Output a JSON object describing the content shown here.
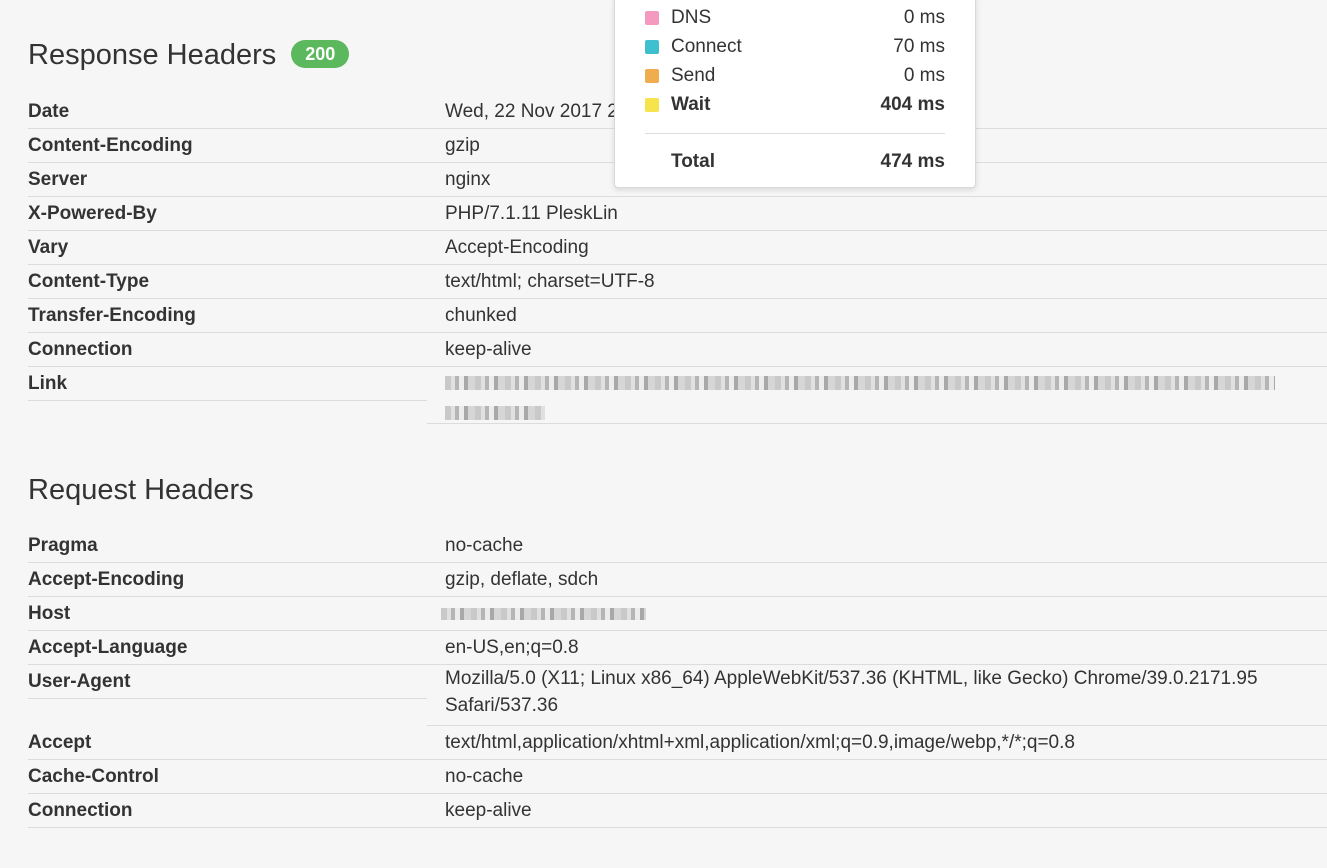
{
  "response": {
    "title": "Response Headers",
    "status": "200",
    "rows": [
      {
        "name": "Date",
        "value": "Wed, 22 Nov 2017 2"
      },
      {
        "name": "Content-Encoding",
        "value": "gzip"
      },
      {
        "name": "Server",
        "value": "nginx"
      },
      {
        "name": "X-Powered-By",
        "value": "PHP/7.1.11 PleskLin"
      },
      {
        "name": "Vary",
        "value": "Accept-Encoding"
      },
      {
        "name": "Content-Type",
        "value": "text/html; charset=UTF-8"
      },
      {
        "name": "Transfer-Encoding",
        "value": "chunked"
      },
      {
        "name": "Connection",
        "value": "keep-alive"
      },
      {
        "name": "Link",
        "value": ""
      }
    ]
  },
  "request": {
    "title": "Request Headers",
    "rows": [
      {
        "name": "Pragma",
        "value": "no-cache"
      },
      {
        "name": "Accept-Encoding",
        "value": "gzip, deflate, sdch"
      },
      {
        "name": "Host",
        "value": ""
      },
      {
        "name": "Accept-Language",
        "value": "en-US,en;q=0.8"
      },
      {
        "name": "User-Agent",
        "value": "Mozilla/5.0 (X11; Linux x86_64) AppleWebKit/537.36 (KHTML, like Gecko) Chrome/39.0.2171.95 Safari/537.36"
      },
      {
        "name": "Accept",
        "value": "text/html,application/xhtml+xml,application/xml;q=0.9,image/webp,*/*;q=0.8"
      },
      {
        "name": "Cache-Control",
        "value": "no-cache"
      },
      {
        "name": "Connection",
        "value": "keep-alive"
      }
    ]
  },
  "timing": {
    "rows": [
      {
        "label": "DNS",
        "value": "0 ms",
        "color": "#f49ac1"
      },
      {
        "label": "Connect",
        "value": "70 ms",
        "color": "#3ec0d0"
      },
      {
        "label": "Send",
        "value": "0 ms",
        "color": "#f0ad4e"
      },
      {
        "label": "Wait",
        "value": "404 ms",
        "color": "#f7e34b"
      }
    ],
    "total_label": "Total",
    "total_value": "474 ms"
  },
  "colors": {
    "badge": "#5cb85c",
    "background": "#f6f6f6"
  }
}
